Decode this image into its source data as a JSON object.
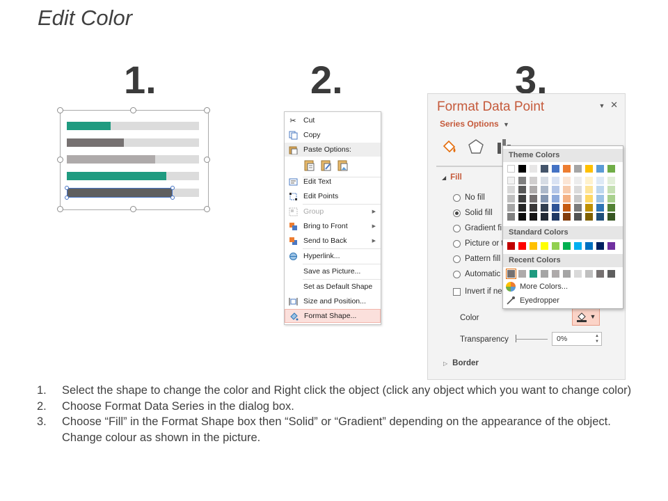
{
  "slide": {
    "title": "Edit Color"
  },
  "steps": {
    "n1": "1.",
    "n2": "2.",
    "n3": "3."
  },
  "panel1": {
    "bars": [
      {
        "fill_fraction": 0.33,
        "color": "#1f9b80"
      },
      {
        "fill_fraction": 0.43,
        "color": "#767171"
      },
      {
        "fill_fraction": 0.67,
        "color": "#aeaaaa"
      },
      {
        "fill_fraction": 0.75,
        "color": "#1f9b80"
      },
      {
        "fill_fraction": 0.8,
        "color": "#5f5f5f"
      }
    ],
    "track_color": "#dcdcdc"
  },
  "context_menu": {
    "items": [
      {
        "label": "Cut",
        "icon": "scissors-icon"
      },
      {
        "label": "Copy",
        "icon": "copy-icon"
      },
      {
        "label": "Paste Options:",
        "icon": "paste-icon"
      },
      {
        "label": "Edit Text",
        "icon": "edit-text-icon"
      },
      {
        "label": "Edit Points",
        "icon": "edit-points-icon"
      },
      {
        "label": "Group",
        "icon": "group-icon"
      },
      {
        "label": "Bring to Front",
        "icon": "bring-to-front-icon"
      },
      {
        "label": "Send to Back",
        "icon": "send-to-back-icon"
      },
      {
        "label": "Hyperlink...",
        "icon": "hyperlink-icon"
      },
      {
        "label": "Save as Picture...",
        "icon": ""
      },
      {
        "label": "Set as Default Shape",
        "icon": ""
      },
      {
        "label": "Size and Position...",
        "icon": "size-position-icon"
      },
      {
        "label": "Format Shape...",
        "icon": "format-shape-icon"
      }
    ]
  },
  "format_pane": {
    "title": "Format Data Point",
    "series_options": "Series Options",
    "fill_heading": "Fill",
    "options": [
      "No fill",
      "Solid fill",
      "Gradient fi",
      "Picture or t",
      "Pattern fill",
      "Automatic",
      "Invert if ne"
    ],
    "selected_option": "Solid fill",
    "color_label": "Color",
    "transparency_label": "Transparency",
    "transparency_value": "0%",
    "border_heading": "Border",
    "accent_color": "#c55a3b"
  },
  "color_picker": {
    "theme_colors_label": "Theme Colors",
    "standard_colors_label": "Standard Colors",
    "recent_colors_label": "Recent Colors",
    "more_colors": "More Colors...",
    "eyedropper": "Eyedropper",
    "theme_top": [
      "#ffffff",
      "#000000",
      "#e7e6e6",
      "#44546a",
      "#4472c4",
      "#ed7d31",
      "#a5a5a5",
      "#ffc000",
      "#5b9bd5",
      "#70ad47"
    ],
    "theme_shades": [
      [
        "#f2f2f2",
        "#7f7f7f",
        "#d0cece",
        "#d6dce4",
        "#d9e2f3",
        "#fbe5d5",
        "#ededed",
        "#fff2cc",
        "#deeaf6",
        "#e2efd9"
      ],
      [
        "#d8d8d8",
        "#595959",
        "#aeabab",
        "#adb9ca",
        "#b4c6e7",
        "#f7cbac",
        "#dbdbdb",
        "#fee599",
        "#bdd7ee",
        "#c5e0b3"
      ],
      [
        "#bfbfbf",
        "#3f3f3f",
        "#757070",
        "#8496b0",
        "#8eaadb",
        "#f4b183",
        "#c9c9c9",
        "#ffd965",
        "#9cc3e5",
        "#a8d08d"
      ],
      [
        "#a5a5a5",
        "#262626",
        "#3a3838",
        "#323f4f",
        "#2f5496",
        "#c55a11",
        "#7b7b7b",
        "#bf9000",
        "#2e75b5",
        "#538135"
      ],
      [
        "#7f7f7f",
        "#0c0c0c",
        "#171616",
        "#222a35",
        "#1f3864",
        "#833c0b",
        "#525252",
        "#7f6000",
        "#1e4e79",
        "#375623"
      ]
    ],
    "standard": [
      "#c00000",
      "#ff0000",
      "#ffc000",
      "#ffff00",
      "#92d050",
      "#00b050",
      "#00b0f0",
      "#0070c0",
      "#002060",
      "#7030a0"
    ],
    "recent": [
      "#767171",
      "#aeaaaa",
      "#1f9b80",
      "#a5a5a5",
      "#aeaaaa",
      "#a5a5a5",
      "#d9d9d9",
      "#bfbfbf",
      "#767171",
      "#5f5f5f"
    ]
  },
  "instructions": [
    {
      "num": "1.",
      "text": "Select the shape to change the color and Right click the object (click any object which you want to change color)"
    },
    {
      "num": "2.",
      "text": "Choose Format Data Series in the dialog box."
    },
    {
      "num": "3.",
      "text": "Choose “Fill” in the Format Shape box then “Solid” or “Gradient” depending on the appearance of the object. Change colour as shown in the picture."
    }
  ]
}
